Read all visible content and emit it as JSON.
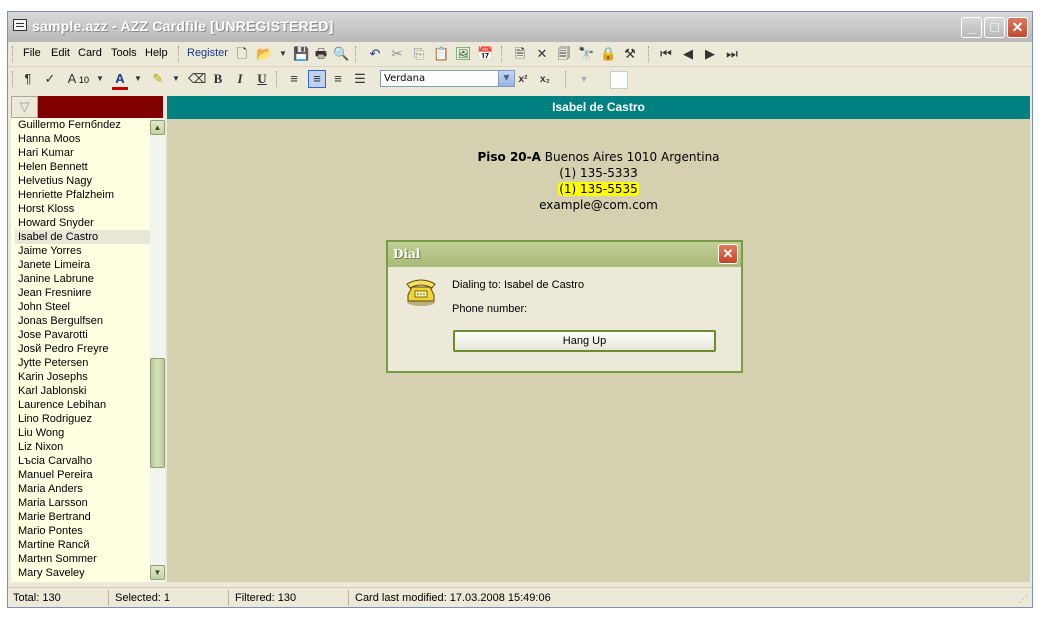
{
  "window": {
    "title": "sample.azz - AZZ Cardfile [UNREGISTERED]",
    "minimize": "_",
    "maximize": "□",
    "close": "✕"
  },
  "menu": {
    "file": "File",
    "edit": "Edit",
    "card": "Card",
    "tools": "Tools",
    "help": "Help",
    "register": "Register"
  },
  "format": {
    "font_name": "Verdana",
    "font_size": "10",
    "bold": "B",
    "italic": "I",
    "underline": "U"
  },
  "contacts": [
    "Guillermo Fernбndez",
    "Hanna Moos",
    "Hari Kumar",
    "Helen Bennett",
    "Helvetius Nagy",
    "Henriette Pfalzheim",
    "Horst Kloss",
    "Howard Snyder",
    "Isabel de Castro",
    "Jaime Yorres",
    "Janete Limeira",
    "Janine Labrune",
    "Jean Fresniиre",
    "John Steel",
    "Jonas Bergulfsen",
    "Jose Pavarotti",
    "Josй Pedro Freyre",
    "Jytte Petersen",
    "Karin Josephs",
    "Karl Jablonski",
    "Laurence Lebihan",
    "Lino Rodriguez",
    "Liu Wong",
    "Liz Nixon",
    "Lъcia Carvalho",
    "Manuel Pereira",
    "Maria Anders",
    "Maria Larsson",
    "Marie Bertrand",
    "Mario Pontes",
    "Martine Rancй",
    "Martнn Sommer",
    "Mary Saveley"
  ],
  "selected_index": 8,
  "card": {
    "name": "Isabel de Castro",
    "address_bold": "Piso 20-A",
    "address_rest": " Buenos Aires  1010 Argentina",
    "phone1": "(1) 135-5333",
    "phone2": "(1) 135-5535",
    "email": "example@com.com"
  },
  "dialog": {
    "title": "Dial",
    "dialing_to": "Dialing to: Isabel de Castro",
    "phone_number_label": "Phone number:",
    "hangup_label": "Hang Up",
    "close": "✕"
  },
  "status": {
    "total": "Total: 130",
    "selected": "Selected: 1",
    "filtered": "Filtered: 130",
    "modified": "Card last modified: 17.03.2008  15:49:06"
  },
  "colors": {
    "card_header": "#008080",
    "card_body": "#d4d0b0",
    "filter_box": "#800000",
    "list_bg": "#ffffe1",
    "highlight": "#ffff00"
  }
}
